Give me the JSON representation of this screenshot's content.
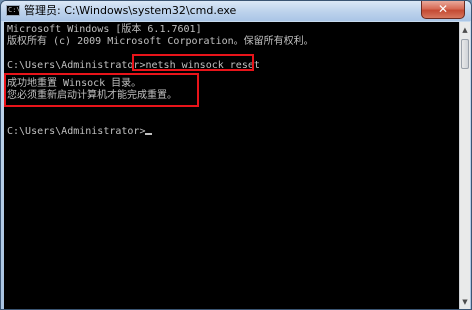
{
  "window": {
    "title": "管理员: C:\\Windows\\system32\\cmd.exe",
    "close_symbol": "✕",
    "app_icon_text": "C:\\"
  },
  "console": {
    "lines": [
      "Microsoft Windows [版本 6.1.7601]",
      "版权所有 (c) 2009 Microsoft Corporation。保留所有权利。",
      "",
      "C:\\Users\\Administrator>netsh winsock reset",
      "",
      "成功地重置 Winsock 目录。",
      "您必须重新启动计算机才能完成重置。",
      "",
      "",
      "C:\\Users\\Administrator>"
    ],
    "prompt": "C:\\Users\\Administrator>",
    "command": "netsh winsock reset",
    "result_line_1": "成功地重置 Winsock 目录。",
    "result_line_2": "您必须重新启动计算机才能完成重置。"
  },
  "colors": {
    "console_bg": "#000000",
    "console_text": "#c0c0c0",
    "highlight_border": "#e8141a",
    "close_button": "#c44a33"
  },
  "scrollbar": {
    "up_arrow": "▲",
    "down_arrow": "▼"
  }
}
